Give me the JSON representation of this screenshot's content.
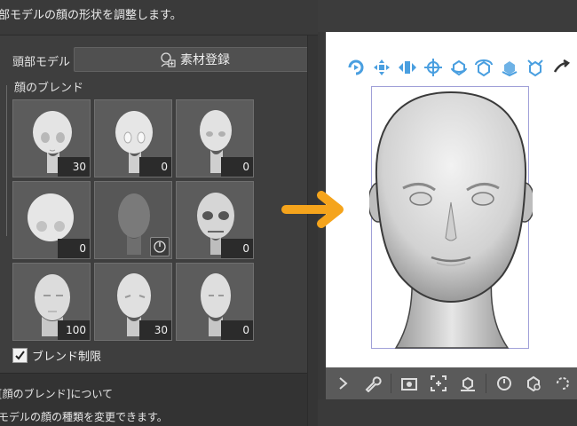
{
  "header": {
    "description": "部モデルの顔の形状を調整します。"
  },
  "head_model": {
    "label": "頭部モデル",
    "register_button": "素材登録"
  },
  "face_blend": {
    "label": "顔のブレンド",
    "cells": [
      {
        "value": "30",
        "style": "anime-child"
      },
      {
        "value": "0",
        "style": "anime-girl"
      },
      {
        "value": "0",
        "style": "anime-teen"
      },
      {
        "value": "0",
        "style": "chibi"
      },
      {
        "value": "",
        "style": "dimmed",
        "has_dial": true
      },
      {
        "value": "0",
        "style": "skull"
      },
      {
        "value": "100",
        "style": "realistic-man"
      },
      {
        "value": "30",
        "style": "lowpoly"
      },
      {
        "value": "0",
        "style": "realistic-slim"
      }
    ],
    "limit_checkbox": {
      "label": "ブレンド制限",
      "checked": true
    }
  },
  "info": {
    "title": "[顔のブレンド]について",
    "body": "モデルの顔の種類を変更できます。"
  },
  "accent_colors": {
    "gizmo": "#4a9fe0",
    "arrow": "#f5a41c",
    "bbox": "#a0a0d8"
  }
}
